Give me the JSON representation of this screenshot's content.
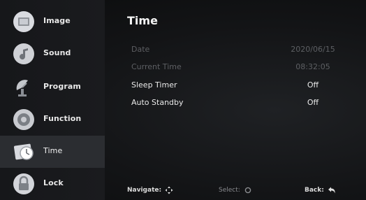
{
  "sidebar": {
    "items": [
      {
        "label": "Image",
        "icon": "image-icon",
        "active": false
      },
      {
        "label": "Sound",
        "icon": "sound-icon",
        "active": false
      },
      {
        "label": "Program",
        "icon": "program-icon",
        "active": false
      },
      {
        "label": "Function",
        "icon": "function-icon",
        "active": false
      },
      {
        "label": "Time",
        "icon": "time-icon",
        "active": true
      },
      {
        "label": "Lock",
        "icon": "lock-icon",
        "active": false
      }
    ]
  },
  "panel": {
    "title": "Time",
    "rows": [
      {
        "label": "Date",
        "value": "2020/06/15",
        "enabled": false
      },
      {
        "label": "Current Time",
        "value": "08:32:05",
        "enabled": false
      },
      {
        "label": "Sleep Timer",
        "value": "Off",
        "enabled": true
      },
      {
        "label": "Auto Standby",
        "value": "Off",
        "enabled": true
      }
    ]
  },
  "footer": {
    "navigate_label": "Navigate:",
    "select_label": "Select:",
    "back_label": "Back:"
  },
  "colors": {
    "background": "#131416",
    "sidebar": "#1a1b1e",
    "active_item": "#2b2d31",
    "text_primary": "#eaeaea",
    "text_disabled": "#5d5f63"
  }
}
